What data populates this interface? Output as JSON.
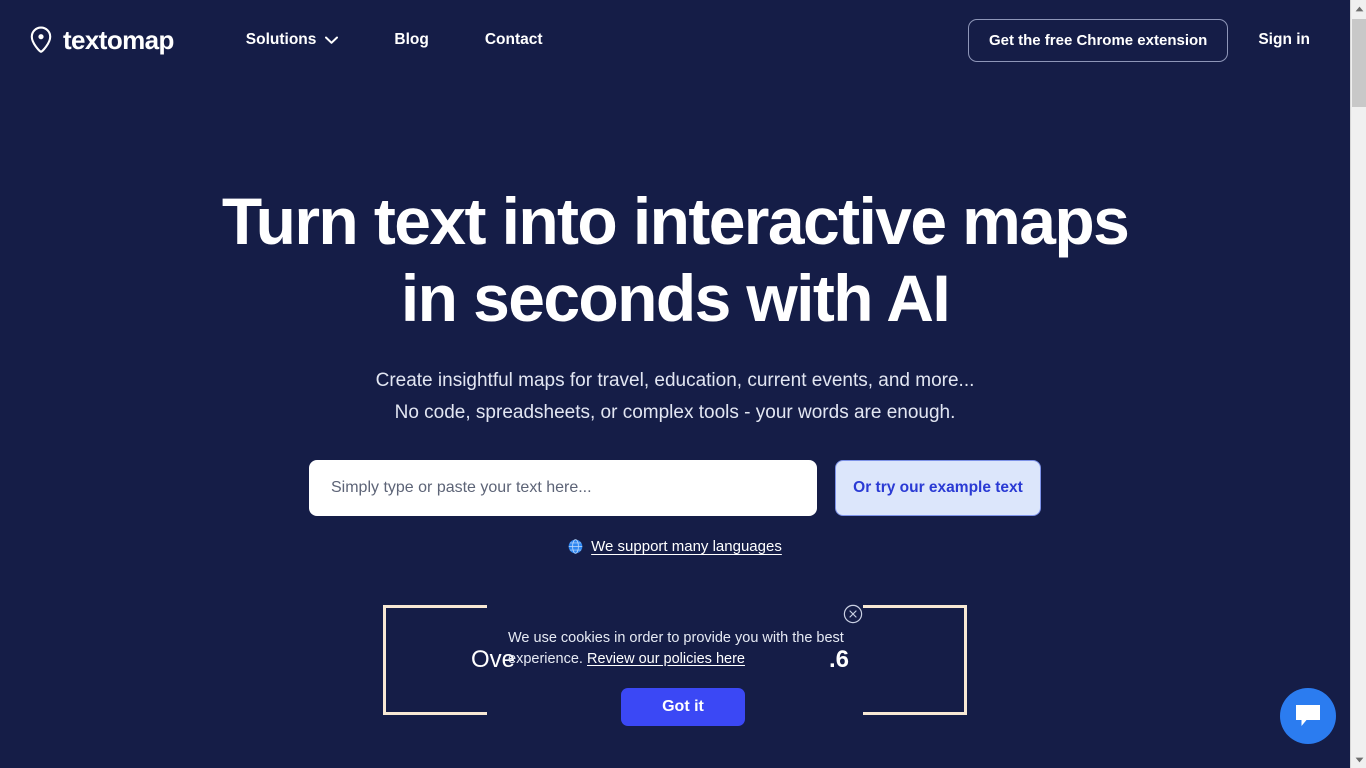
{
  "theme": {
    "background": "#151d47",
    "accent_blue": "#3b48f5",
    "light_blue": "#dce6fb",
    "cream": "#f7e8d4",
    "chat_blue": "#2b7cf0"
  },
  "header": {
    "brand_name": "textomap",
    "brand_icon": "map-pin-icon",
    "nav": [
      {
        "label": "Solutions",
        "has_dropdown": true
      },
      {
        "label": "Blog",
        "has_dropdown": false
      },
      {
        "label": "Contact",
        "has_dropdown": false
      }
    ],
    "extension_button": "Get the free Chrome extension",
    "signin": "Sign in"
  },
  "hero": {
    "headline_line1": "Turn text into interactive maps",
    "headline_line2": "in seconds with AI",
    "subtitle_line1": "Create insightful maps for travel, education, current events, and more...",
    "subtitle_line2": "No code, spreadsheets, or complex tools - your words are enough.",
    "search_placeholder": "Simply type or paste your text here...",
    "search_value": "",
    "example_button": "Or try our example text",
    "languages_link": "We support many languages",
    "globe_icon": "globe-icon"
  },
  "stats": {
    "left_text": "Ove",
    "right_text": ".6"
  },
  "cookie_banner": {
    "text": "We use cookies in order to provide you with the best experience.",
    "link": "Review our policies here",
    "accept_button": "Got it",
    "close_icon": "close-circle-icon"
  },
  "chat": {
    "icon": "chat-bubble-icon"
  },
  "scrollbar": {
    "up_arrow": "chevron-up-icon",
    "down_arrow": "chevron-down-icon"
  }
}
